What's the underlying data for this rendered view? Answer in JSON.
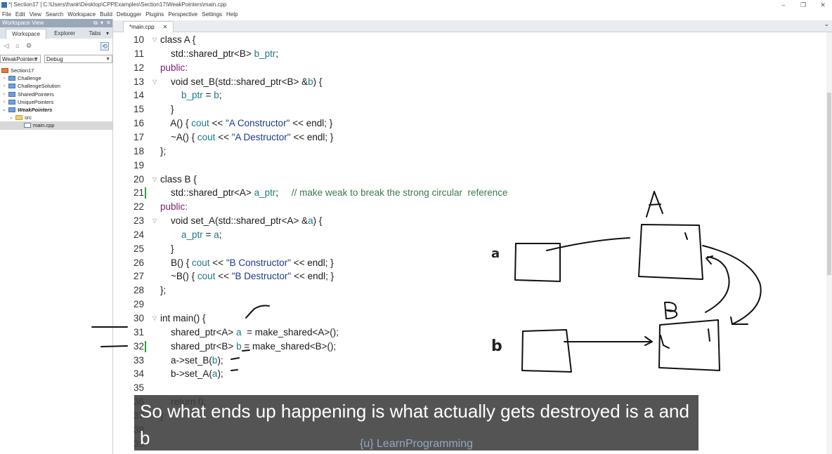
{
  "window": {
    "title": "*| Section17 | C:\\Users\\frank\\Desktop\\CPPExamples\\Section17\\WeakPointers\\main.cpp",
    "controls": [
      "–",
      "❐",
      "✕"
    ]
  },
  "menu": [
    "File",
    "Edit",
    "View",
    "Search",
    "Workspace",
    "Build",
    "Debugger",
    "Plugins",
    "Perspective",
    "Settings",
    "Help"
  ],
  "workspace_panel": {
    "header": "Workspace View",
    "tabs": [
      "Workspace",
      "Explorer",
      "Tabs"
    ],
    "project_select": "WeakPointers",
    "config_select": "Debug",
    "tree": [
      {
        "label": "Section17",
        "level": 0,
        "icon": "workspace-icon",
        "expander": ""
      },
      {
        "label": "Challenge",
        "level": 1,
        "icon": "folder-icon",
        "expander": "›"
      },
      {
        "label": "ChallengeSolution",
        "level": 1,
        "icon": "folder-icon",
        "expander": "›"
      },
      {
        "label": "SharedPointers",
        "level": 1,
        "icon": "folder-icon",
        "expander": "›"
      },
      {
        "label": "UniquePointers",
        "level": 1,
        "icon": "folder-icon",
        "expander": "›"
      },
      {
        "label": "WeakPointers",
        "level": 1,
        "icon": "folder-icon",
        "expander": "⌄",
        "bold": true
      },
      {
        "label": "src",
        "level": 2,
        "icon": "src-folder-icon",
        "expander": "⌄"
      },
      {
        "label": "main.cpp",
        "level": 3,
        "icon": "cpp-file-icon",
        "expander": "",
        "selected": true
      }
    ]
  },
  "editor": {
    "tab_label": "*main.cpp",
    "tab_close": "✕",
    "lines": [
      {
        "num": "10",
        "fold": "▽",
        "tokens": [
          {
            "t": "class A {",
            "c": "kw-lead"
          }
        ]
      },
      {
        "num": "11",
        "tokens": [
          {
            "t": "    std::shared_ptr<B> ",
            "c": ""
          },
          {
            "t": "b_ptr",
            "c": "ty"
          },
          {
            "t": ";",
            "c": ""
          }
        ]
      },
      {
        "num": "12",
        "tokens": [
          {
            "t": "public:",
            "c": "kw"
          }
        ]
      },
      {
        "num": "13",
        "fold": "▽",
        "tokens": [
          {
            "t": "    void set_B(std::shared_ptr<B> &",
            "c": ""
          },
          {
            "t": "b",
            "c": "ty"
          },
          {
            "t": ") {",
            "c": ""
          }
        ]
      },
      {
        "num": "14",
        "tokens": [
          {
            "t": "        ",
            "c": ""
          },
          {
            "t": "b_ptr",
            "c": "ty"
          },
          {
            "t": " = ",
            "c": ""
          },
          {
            "t": "b",
            "c": "ty"
          },
          {
            "t": ";",
            "c": ""
          }
        ]
      },
      {
        "num": "15",
        "tokens": [
          {
            "t": "    }",
            "c": ""
          }
        ]
      },
      {
        "num": "16",
        "tokens": [
          {
            "t": "    A() { ",
            "c": ""
          },
          {
            "t": "cout",
            "c": "ty"
          },
          {
            "t": " << ",
            "c": ""
          },
          {
            "t": "\"A Constructor\"",
            "c": "st"
          },
          {
            "t": " << endl; }",
            "c": ""
          }
        ]
      },
      {
        "num": "17",
        "tokens": [
          {
            "t": "    ~A() { ",
            "c": ""
          },
          {
            "t": "cout",
            "c": "ty"
          },
          {
            "t": " << ",
            "c": ""
          },
          {
            "t": "\"A Destructor\"",
            "c": "st"
          },
          {
            "t": " << endl; }",
            "c": ""
          }
        ]
      },
      {
        "num": "18",
        "tokens": [
          {
            "t": "};",
            "c": ""
          }
        ]
      },
      {
        "num": "19",
        "tokens": []
      },
      {
        "num": "20",
        "fold": "▽",
        "tokens": [
          {
            "t": "class B {",
            "c": "kw-lead"
          }
        ]
      },
      {
        "num": "21",
        "changed": true,
        "tokens": [
          {
            "t": "    std::shared_ptr<A> ",
            "c": ""
          },
          {
            "t": "a_ptr",
            "c": "ty"
          },
          {
            "t": ";     ",
            "c": ""
          },
          {
            "t": "// make weak to break the strong circular  reference",
            "c": "cm"
          }
        ]
      },
      {
        "num": "22",
        "tokens": [
          {
            "t": "public:",
            "c": "kw"
          }
        ]
      },
      {
        "num": "23",
        "fold": "▽",
        "tokens": [
          {
            "t": "    void set_A(std::shared_ptr<A> &",
            "c": ""
          },
          {
            "t": "a",
            "c": "ty"
          },
          {
            "t": ") {",
            "c": ""
          }
        ]
      },
      {
        "num": "24",
        "tokens": [
          {
            "t": "        ",
            "c": ""
          },
          {
            "t": "a_ptr",
            "c": "ty"
          },
          {
            "t": " = ",
            "c": ""
          },
          {
            "t": "a",
            "c": "ty"
          },
          {
            "t": ";",
            "c": ""
          }
        ]
      },
      {
        "num": "25",
        "tokens": [
          {
            "t": "    }",
            "c": ""
          }
        ]
      },
      {
        "num": "26",
        "tokens": [
          {
            "t": "    B() { ",
            "c": ""
          },
          {
            "t": "cout",
            "c": "ty"
          },
          {
            "t": " << ",
            "c": ""
          },
          {
            "t": "\"B Constructor\"",
            "c": "st"
          },
          {
            "t": " << endl; }",
            "c": ""
          }
        ]
      },
      {
        "num": "27",
        "tokens": [
          {
            "t": "    ~B() { ",
            "c": ""
          },
          {
            "t": "cout",
            "c": "ty"
          },
          {
            "t": " << ",
            "c": ""
          },
          {
            "t": "\"B Destructor\"",
            "c": "st"
          },
          {
            "t": " << endl; }",
            "c": ""
          }
        ]
      },
      {
        "num": "28",
        "tokens": [
          {
            "t": "};",
            "c": ""
          }
        ]
      },
      {
        "num": "29",
        "tokens": []
      },
      {
        "num": "30",
        "fold": "▽",
        "tokens": [
          {
            "t": "int main() {",
            "c": ""
          }
        ]
      },
      {
        "num": "31",
        "tokens": [
          {
            "t": "    shared_ptr<A> ",
            "c": ""
          },
          {
            "t": "a",
            "c": "ty"
          },
          {
            "t": "  = make_shared<A>();",
            "c": ""
          }
        ]
      },
      {
        "num": "32",
        "changed": true,
        "tokens": [
          {
            "t": "    shared_ptr<B> ",
            "c": ""
          },
          {
            "t": "b",
            "c": "ty"
          },
          {
            "t": " = make_shared<B>();",
            "c": ""
          }
        ]
      },
      {
        "num": "33",
        "tokens": [
          {
            "t": "    a->set_B(",
            "c": ""
          },
          {
            "t": "b",
            "c": "ty"
          },
          {
            "t": ");",
            "c": ""
          }
        ]
      },
      {
        "num": "34",
        "tokens": [
          {
            "t": "    b->set_A(",
            "c": ""
          },
          {
            "t": "a",
            "c": "ty"
          },
          {
            "t": ");",
            "c": ""
          }
        ]
      },
      {
        "num": "35",
        "tokens": []
      },
      {
        "num": "36",
        "tokens": [
          {
            "t": "    return 0;",
            "c": ""
          }
        ]
      },
      {
        "num": "37",
        "tokens": [
          {
            "t": "}",
            "c": ""
          }
        ]
      },
      {
        "num": "38",
        "tokens": []
      },
      {
        "num": "39",
        "tokens": []
      }
    ]
  },
  "whiteboard": {
    "labels": {
      "A": "A",
      "B": "B",
      "a": "a",
      "b": "b",
      "countA": "1",
      "countB": "1"
    }
  },
  "caption": "So what ends up happening is what actually gets destroyed is a and b",
  "watermark": "{u} LearnProgramming",
  "colors": {
    "keyword": "#7a1f6e",
    "type": "#1a7a8a",
    "string": "#1b3b8f",
    "comment": "#3a7a4a",
    "caption_bg": "#3c3c3c"
  }
}
